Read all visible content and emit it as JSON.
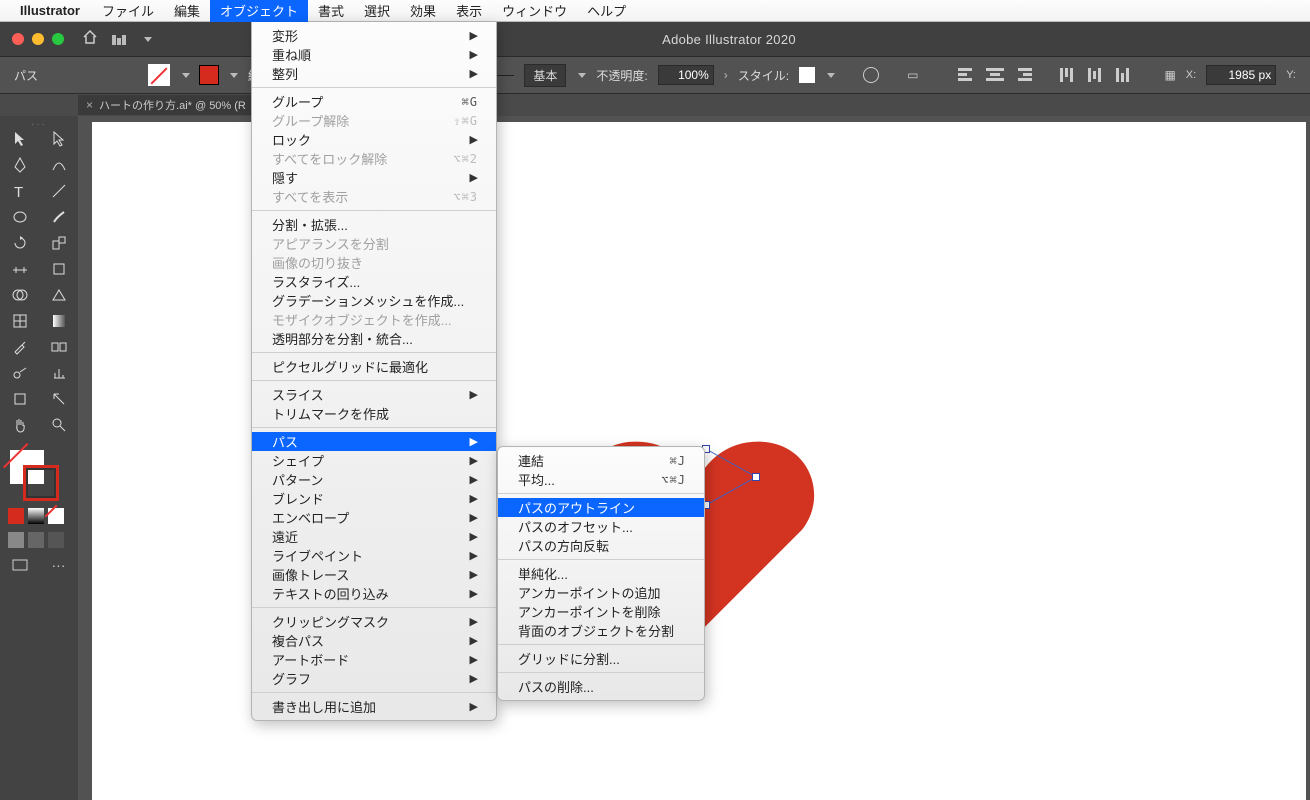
{
  "mac_menu": {
    "app": "Illustrator",
    "items": [
      "ファイル",
      "編集",
      "オブジェクト",
      "書式",
      "選択",
      "効果",
      "表示",
      "ウィンドウ",
      "ヘルプ"
    ],
    "active_index": 2
  },
  "window": {
    "title": "Adobe Illustrator 2020"
  },
  "control_bar": {
    "context": "パス",
    "stroke_label_short": "線",
    "profile_label": "基本",
    "opacity_label": "不透明度:",
    "opacity_value": "100%",
    "style_label": "スタイル:",
    "x_label": "X:",
    "x_value": "1985 px",
    "y_label": "Y:"
  },
  "doc_tab": {
    "name": "ハートの作り方.ai* @ 50% (R"
  },
  "object_menu": {
    "groups": [
      [
        {
          "label": "変形",
          "arrow": true
        },
        {
          "label": "重ね順",
          "arrow": true
        },
        {
          "label": "整列",
          "arrow": true
        }
      ],
      [
        {
          "label": "グループ",
          "shortcut": "⌘G"
        },
        {
          "label": "グループ解除",
          "shortcut": "⇧⌘G",
          "disabled": true
        },
        {
          "label": "ロック",
          "arrow": true
        },
        {
          "label": "すべてをロック解除",
          "shortcut": "⌥⌘2",
          "disabled": true
        },
        {
          "label": "隠す",
          "arrow": true
        },
        {
          "label": "すべてを表示",
          "shortcut": "⌥⌘3",
          "disabled": true
        }
      ],
      [
        {
          "label": "分割・拡張..."
        },
        {
          "label": "アピアランスを分割",
          "disabled": true
        },
        {
          "label": "画像の切り抜き",
          "disabled": true
        },
        {
          "label": "ラスタライズ..."
        },
        {
          "label": "グラデーションメッシュを作成..."
        },
        {
          "label": "モザイクオブジェクトを作成...",
          "disabled": true
        },
        {
          "label": "透明部分を分割・統合..."
        }
      ],
      [
        {
          "label": "ピクセルグリッドに最適化"
        }
      ],
      [
        {
          "label": "スライス",
          "arrow": true
        },
        {
          "label": "トリムマークを作成"
        }
      ],
      [
        {
          "label": "パス",
          "arrow": true,
          "highlight": true
        },
        {
          "label": "シェイプ",
          "arrow": true
        },
        {
          "label": "パターン",
          "arrow": true
        },
        {
          "label": "ブレンド",
          "arrow": true
        },
        {
          "label": "エンベロープ",
          "arrow": true
        },
        {
          "label": "遠近",
          "arrow": true
        },
        {
          "label": "ライブペイント",
          "arrow": true
        },
        {
          "label": "画像トレース",
          "arrow": true
        },
        {
          "label": "テキストの回り込み",
          "arrow": true
        }
      ],
      [
        {
          "label": "クリッピングマスク",
          "arrow": true
        },
        {
          "label": "複合パス",
          "arrow": true
        },
        {
          "label": "アートボード",
          "arrow": true
        },
        {
          "label": "グラフ",
          "arrow": true
        }
      ],
      [
        {
          "label": "書き出し用に追加",
          "arrow": true
        }
      ]
    ]
  },
  "path_submenu": {
    "groups": [
      [
        {
          "label": "連結",
          "shortcut": "⌘J"
        },
        {
          "label": "平均...",
          "shortcut": "⌥⌘J"
        }
      ],
      [
        {
          "label": "パスのアウトライン",
          "highlight": true
        },
        {
          "label": "パスのオフセット..."
        },
        {
          "label": "パスの方向反転"
        }
      ],
      [
        {
          "label": "単純化..."
        },
        {
          "label": "アンカーポイントの追加"
        },
        {
          "label": "アンカーポイントを削除"
        },
        {
          "label": "背面のオブジェクトを分割"
        }
      ],
      [
        {
          "label": "グリッドに分割..."
        }
      ],
      [
        {
          "label": "パスの削除..."
        }
      ]
    ]
  },
  "tools": {
    "rows": [
      [
        "selection-tool",
        "direct-selection-tool"
      ],
      [
        "pen-tool",
        "curvature-tool"
      ],
      [
        "type-tool",
        "line-tool"
      ],
      [
        "ellipse-tool",
        "brush-tool"
      ],
      [
        "rotate-tool",
        "scale-tool"
      ],
      [
        "width-tool",
        "free-transform-tool"
      ],
      [
        "shape-builder-tool",
        "perspective-tool"
      ],
      [
        "mesh-tool",
        "gradient-tool"
      ],
      [
        "eyedropper-tool",
        "blend-tool"
      ],
      [
        "symbol-sprayer-tool",
        "graph-tool"
      ],
      [
        "artboard-tool",
        "slice-tool"
      ],
      [
        "hand-tool",
        "zoom-tool"
      ]
    ]
  }
}
